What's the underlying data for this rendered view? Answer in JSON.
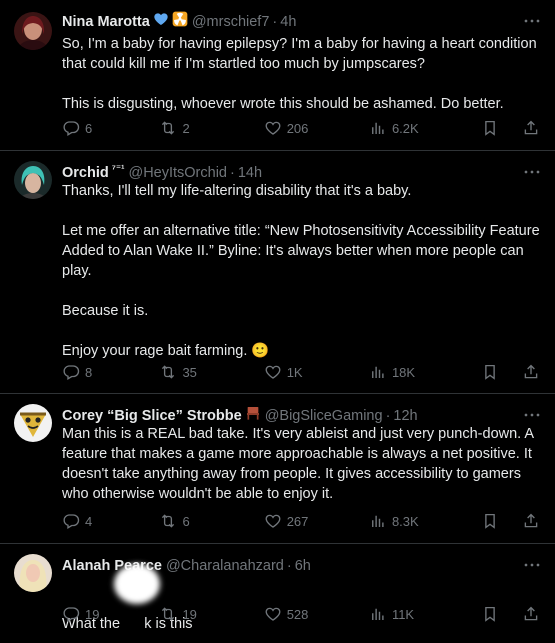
{
  "tweets": [
    {
      "name": "Nina Marotta",
      "badges": [
        "blue-heart",
        "radioactive"
      ],
      "handle": "@mrschief7",
      "time": "4h",
      "paragraphs": [
        "So, I'm a baby for having epilepsy? I'm a baby for having a heart condition that could kill me if I'm startled too much by jumpscares?",
        "This is disgusting, whoever wrote this should be ashamed. Do better."
      ],
      "replies": "6",
      "retweets": "2",
      "likes": "206",
      "views": "6.2K"
    },
    {
      "name": "Orchid",
      "name_suffix": "⁷⁼¹",
      "handle": "@HeyItsOrchid",
      "time": "14h",
      "paragraphs": [
        "Thanks, I'll tell my life-altering disability that it's a baby.",
        "Let me offer an alternative title: “New Photosensitivity Accessibility Feature Added to Alan Wake II.” Byline: It's always better when more people can play.",
        "Because it is.",
        "Enjoy your rage bait farming. 🙂"
      ],
      "replies": "8",
      "retweets": "35",
      "likes": "1K",
      "views": "18K"
    },
    {
      "name": "Corey “Big Slice” Strobbe",
      "badges": [
        "chair"
      ],
      "handle": "@BigSliceGaming",
      "time": "12h",
      "paragraphs": [
        "Man this is a REAL bad take.  It's very ableist and just very punch-down.  A feature that makes a game more approachable is always a net positive.  It doesn't take anything away from people.  It gives accessibility to gamers who otherwise wouldn't be able to enjoy it."
      ],
      "replies": "4",
      "retweets": "6",
      "likes": "267",
      "views": "8.3K"
    },
    {
      "name": "Alanah Pearce",
      "handle": "@Charalanahzard",
      "time": "6h",
      "paragraphs": [
        "What the      k is this"
      ],
      "replies": "19",
      "retweets": "19",
      "likes": "528",
      "views": "11K"
    }
  ],
  "colors": {
    "background": "#000000",
    "text": "#e7e9ea",
    "muted": "#71767b",
    "divider": "#2f3336"
  },
  "icons": [
    "reply-icon",
    "retweet-icon",
    "like-icon",
    "views-icon",
    "bookmark-icon",
    "share-icon",
    "more-icon"
  ]
}
